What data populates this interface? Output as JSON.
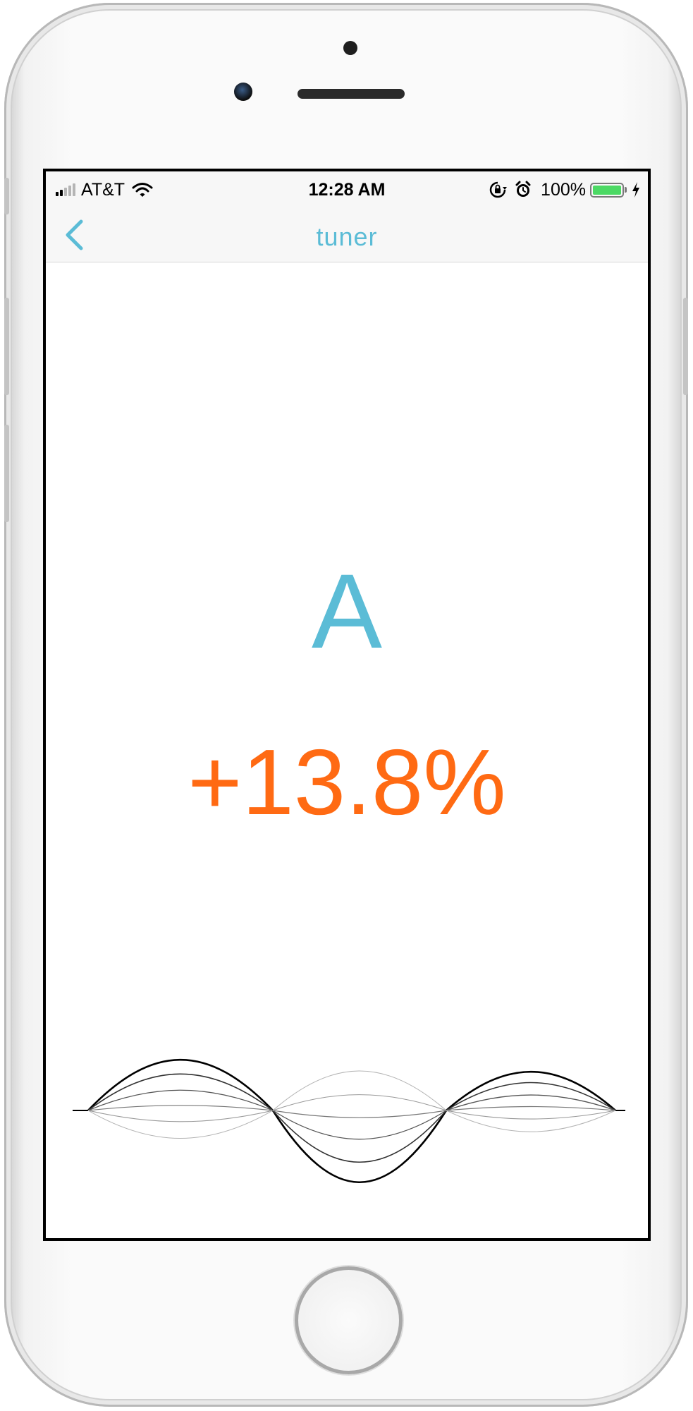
{
  "status_bar": {
    "carrier": "AT&T",
    "time": "12:28 AM",
    "battery_percent_label": "100%",
    "battery_level": 1.0,
    "signal_bars_active": 2,
    "signal_bars_total": 5,
    "icons": [
      "signal-bars-icon",
      "wifi-icon",
      "orientation-lock-icon",
      "alarm-icon",
      "battery-icon",
      "charging-bolt-icon"
    ]
  },
  "nav": {
    "title": "tuner",
    "back_icon": "chevron-left-icon"
  },
  "tuner": {
    "note": "A",
    "deviation": "+13.8%"
  },
  "colors": {
    "accent": "#5bbcd6",
    "deviation": "#ff6a13",
    "battery": "#4cd964",
    "text": "#000000"
  }
}
